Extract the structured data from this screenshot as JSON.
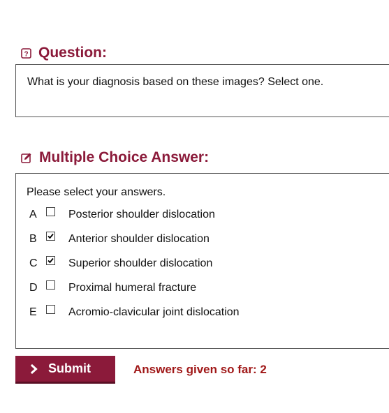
{
  "colors": {
    "accent": "#8b1a3a",
    "count_text": "#a01818"
  },
  "question": {
    "heading": "Question:",
    "icon": "help-icon",
    "text": "What is your diagnosis based on these images? Select one."
  },
  "answer": {
    "heading": "Multiple Choice Answer:",
    "icon": "edit-icon",
    "instructions": "Please select your answers.",
    "options": [
      {
        "letter": "A",
        "label": "Posterior shoulder dislocation",
        "checked": false
      },
      {
        "letter": "B",
        "label": "Anterior shoulder dislocation",
        "checked": true
      },
      {
        "letter": "C",
        "label": "Superior shoulder dislocation",
        "checked": true
      },
      {
        "letter": "D",
        "label": "Proximal humeral fracture",
        "checked": false
      },
      {
        "letter": "E",
        "label": "Acromio-clavicular joint dislocation",
        "checked": false
      }
    ]
  },
  "submit": {
    "label": "Submit",
    "icon": "chevron-right-icon"
  },
  "status": {
    "answers_given": "Answers given so far: 2"
  }
}
